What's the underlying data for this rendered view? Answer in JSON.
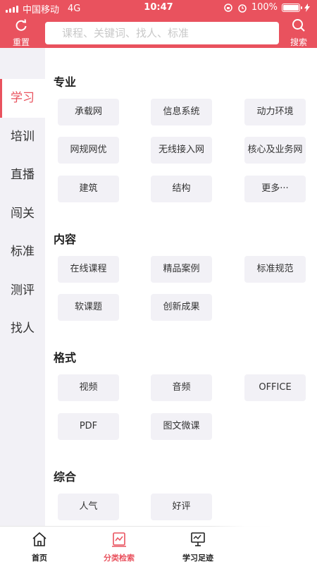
{
  "status_bar": {
    "carrier": "中国移动",
    "network": "4G",
    "time": "10:47",
    "battery": "100%"
  },
  "header": {
    "reset_label": "重置",
    "search_placeholder": "课程、关键词、找人、标准",
    "search_value": "",
    "search_label": "搜索",
    "accent_color": "#e9525e"
  },
  "sidebar": {
    "items": [
      {
        "label": "学习",
        "active": true
      },
      {
        "label": "培训"
      },
      {
        "label": "直播"
      },
      {
        "label": "闯关"
      },
      {
        "label": "标准"
      },
      {
        "label": "测评"
      },
      {
        "label": "找人"
      }
    ]
  },
  "main": {
    "sections": [
      {
        "title": "专业",
        "chips": [
          "承载网",
          "信息系统",
          "动力环境",
          "网规网优",
          "无线接入网",
          "核心及业务网",
          "建筑",
          "结构",
          "更多···"
        ]
      },
      {
        "title": "内容",
        "chips": [
          "在线课程",
          "精品案例",
          "标准规范",
          "软课题",
          "创新成果"
        ]
      },
      {
        "title": "格式",
        "chips": [
          "视频",
          "音频",
          "OFFICE",
          "PDF",
          "图文微课"
        ]
      },
      {
        "title": "综合",
        "chips": [
          "人气",
          "好评"
        ]
      }
    ]
  },
  "tabbar": {
    "tabs": [
      {
        "label": "首页",
        "icon": "home-icon"
      },
      {
        "label": "分类检索",
        "icon": "category-search-icon",
        "active": true
      },
      {
        "label": "学习足迹",
        "icon": "monitor-icon"
      }
    ]
  }
}
